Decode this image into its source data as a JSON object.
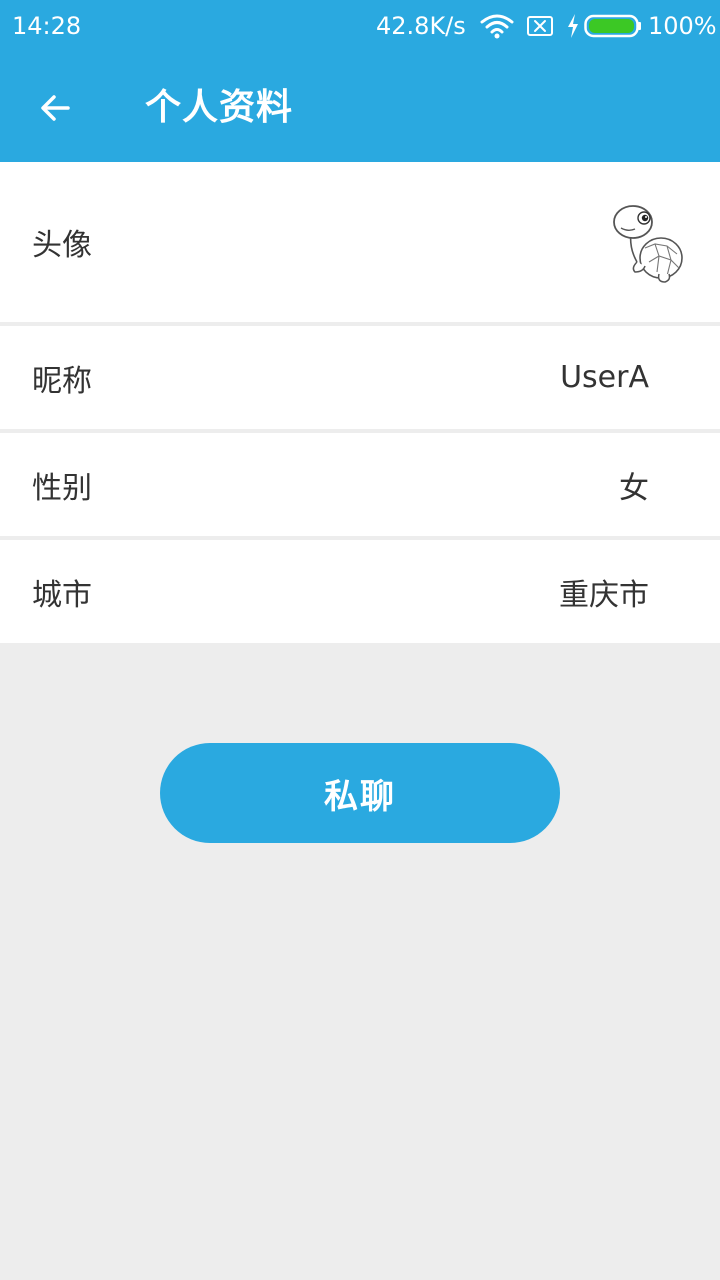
{
  "status_bar": {
    "time": "14:28",
    "network_speed": "42.8K/s",
    "battery_percent": "100%",
    "icons": [
      "wifi-icon",
      "sim-off-icon",
      "charging-icon",
      "battery-icon"
    ]
  },
  "header": {
    "title": "个人资料",
    "back_icon": "arrow-left-icon"
  },
  "profile": {
    "avatar_label": "头像",
    "avatar_image": "turtle-cartoon",
    "nickname_label": "昵称",
    "nickname_value": "UserA",
    "gender_label": "性别",
    "gender_value": "女",
    "city_label": "城市",
    "city_value": "重庆市"
  },
  "actions": {
    "private_chat_label": "私聊"
  },
  "colors": {
    "accent": "#2aa9e0",
    "background": "#ededed",
    "row_background": "#ffffff",
    "text": "#333333",
    "battery_fill": "#3cc825"
  }
}
